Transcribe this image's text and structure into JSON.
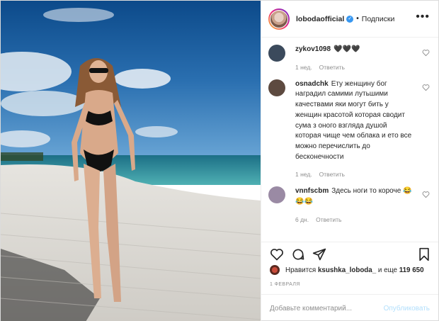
{
  "post": {
    "username": "lobodaofficial",
    "verified_mark": "✓",
    "dot": "•",
    "follow_label": "Подписки",
    "more_icon": "•••"
  },
  "comments": [
    {
      "user": "zykov1098",
      "text": "🖤🖤🖤",
      "time": "1 нед.",
      "reply": "Ответить",
      "avatar_color": "#3b4a5c"
    },
    {
      "user": "osnadchk",
      "text": "Ету женщину бог наградил самими лутьшими качествами яки могут бить у женщин красотой которая сводит сума з оного взгляда душой которая чище чем облака и ето все можно перечислить до бесконечности",
      "time": "1 нед.",
      "reply": "Ответить",
      "avatar_color": "#5d4a40"
    },
    {
      "user": "vnnfscbm",
      "text": "Здесь ноги то короче 😂😂😂",
      "time": "6 дн.",
      "reply": "Ответить",
      "avatar_color": "#9a8aa4"
    }
  ],
  "likes": {
    "prefix": "Нравится",
    "user": "ksushka_loboda_",
    "middle": "и еще",
    "count": "119 650"
  },
  "date": "1 ФЕВРАЛЯ",
  "add_comment": {
    "placeholder": "Добавьте комментарий...",
    "publish": "Опубликовать"
  },
  "icons": [
    "heart-icon",
    "comment-icon",
    "share-icon",
    "bookmark-icon"
  ]
}
